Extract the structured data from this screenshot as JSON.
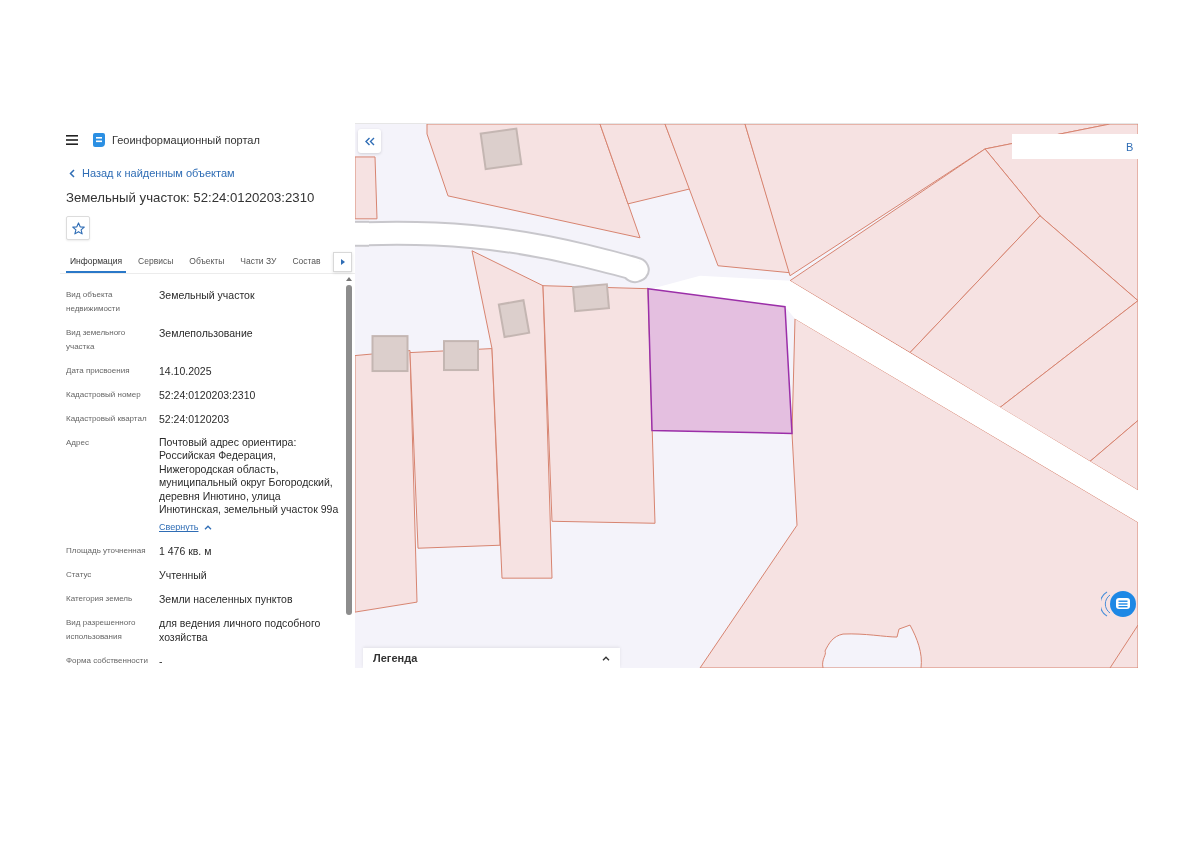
{
  "header": {
    "title": "Геоинформационный портал"
  },
  "back_link": {
    "label": "Назад к найденным объектам"
  },
  "object": {
    "title": "Земельный участок: 52:24:0120203:2310"
  },
  "tabs": [
    {
      "label": "Информация",
      "selected": true
    },
    {
      "label": "Сервисы",
      "selected": false
    },
    {
      "label": "Объекты",
      "selected": false
    },
    {
      "label": "Части ЗУ",
      "selected": false
    },
    {
      "label": "Состав",
      "selected": false
    }
  ],
  "properties": [
    {
      "kind": "text",
      "label": "Вид объекта недвижимости",
      "value": "Земельный участок"
    },
    {
      "kind": "text",
      "label": "Вид земельного участка",
      "value": "Землепользование"
    },
    {
      "kind": "text",
      "label": "Дата присвоения",
      "value": "14.10.2025"
    },
    {
      "kind": "text",
      "label": "Кадастровый номер",
      "value": "52:24:0120203:2310"
    },
    {
      "kind": "text",
      "label": "Кадастровый квартал",
      "value": "52:24:0120203"
    },
    {
      "kind": "expandable",
      "label": "Адрес",
      "value": "Почтовый адрес ориентира: Российская Федерация, Нижегородская область, муниципальный округ Богородский, деревня Инютино, улица Инютинская, земельный участок 99а",
      "toggle": "Свернуть",
      "expanded": true
    },
    {
      "kind": "text",
      "label": "Площадь уточненная",
      "value": "1 476 кв. м"
    },
    {
      "kind": "text",
      "label": "Статус",
      "value": "Учтенный"
    },
    {
      "kind": "text",
      "label": "Категория земель",
      "value": "Земли населенных пунктов"
    },
    {
      "kind": "text",
      "label": "Вид разрешенного использования",
      "value": "для ведения личного подсобного хозяйства"
    },
    {
      "kind": "text",
      "label": "Форма собственности",
      "value": "-"
    }
  ],
  "map": {
    "search_button": "В",
    "legend": {
      "title": "Легенда",
      "expanded": false
    }
  }
}
